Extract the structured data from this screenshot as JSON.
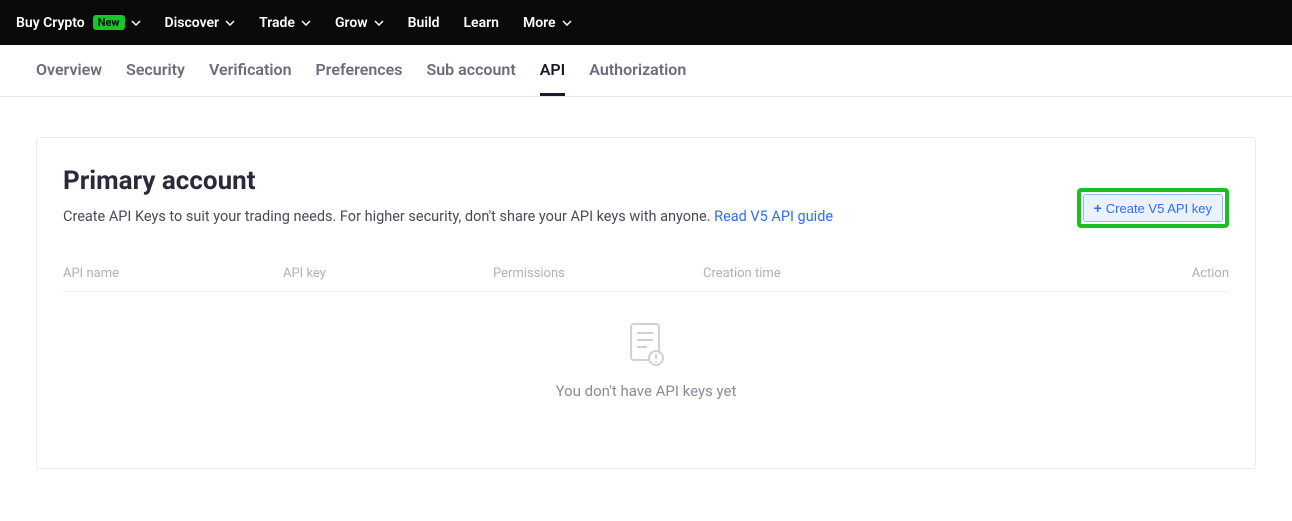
{
  "topnav": {
    "items": [
      {
        "label": "Buy Crypto",
        "badge": "New",
        "dropdown": true
      },
      {
        "label": "Discover",
        "dropdown": true
      },
      {
        "label": "Trade",
        "dropdown": true
      },
      {
        "label": "Grow",
        "dropdown": true
      },
      {
        "label": "Build",
        "dropdown": false
      },
      {
        "label": "Learn",
        "dropdown": false
      },
      {
        "label": "More",
        "dropdown": true
      }
    ]
  },
  "subtabs": {
    "items": [
      "Overview",
      "Security",
      "Verification",
      "Preferences",
      "Sub account",
      "API",
      "Authorization"
    ],
    "active": "API"
  },
  "content": {
    "title": "Primary account",
    "description_prefix": "Create API Keys to suit your trading needs. For higher security, don't share your API keys with anyone. ",
    "guide_link_text": "Read V5 API guide",
    "create_button": "Create V5 API key",
    "table_headers": {
      "name": "API name",
      "key": "API key",
      "permissions": "Permissions",
      "creation_time": "Creation time",
      "action": "Action"
    },
    "empty_message": "You don't have API keys yet"
  }
}
